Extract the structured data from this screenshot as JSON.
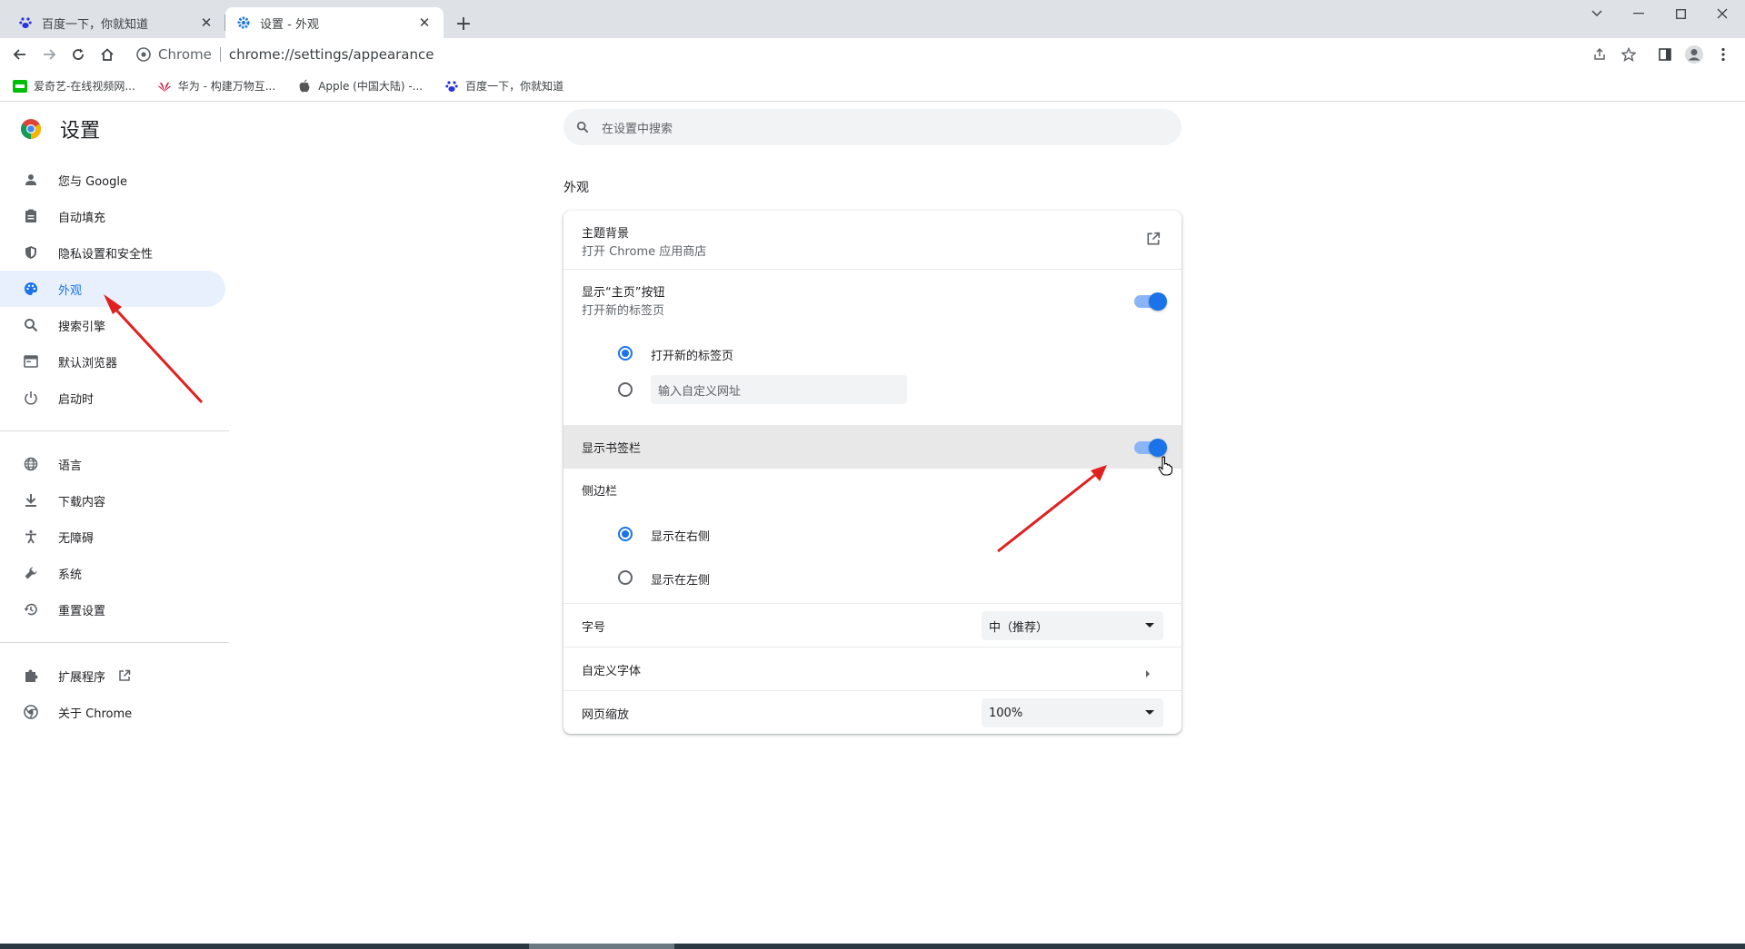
{
  "tabs": [
    {
      "title": "百度一下，你就知道",
      "icon": "baidu-paw-icon",
      "active": false
    },
    {
      "title": "设置 - 外观",
      "icon": "settings-gear-icon",
      "active": true
    }
  ],
  "omnibox": {
    "chip": "Chrome",
    "url": "chrome://settings/appearance"
  },
  "bookmarks": [
    {
      "label": "爱奇艺-在线视频网...",
      "icon": "iqiyi-icon"
    },
    {
      "label": "华为 - 构建万物互...",
      "icon": "huawei-icon"
    },
    {
      "label": "Apple (中国大陆) -...",
      "icon": "apple-icon"
    },
    {
      "label": "百度一下，你就知道",
      "icon": "baidu-paw-icon"
    }
  ],
  "settings_title": "设置",
  "search_placeholder": "在设置中搜索",
  "nav": {
    "group1": [
      {
        "label": "您与 Google",
        "icon": "person-icon"
      },
      {
        "label": "自动填充",
        "icon": "clipboard-icon"
      },
      {
        "label": "隐私设置和安全性",
        "icon": "shield-icon"
      },
      {
        "label": "外观",
        "icon": "palette-icon",
        "selected": true
      },
      {
        "label": "搜索引擎",
        "icon": "search-icon"
      },
      {
        "label": "默认浏览器",
        "icon": "browser-window-icon"
      },
      {
        "label": "启动时",
        "icon": "power-icon"
      }
    ],
    "group2": [
      {
        "label": "语言",
        "icon": "globe-icon"
      },
      {
        "label": "下载内容",
        "icon": "download-icon"
      },
      {
        "label": "无障碍",
        "icon": "accessibility-icon"
      },
      {
        "label": "系统",
        "icon": "wrench-icon"
      },
      {
        "label": "重置设置",
        "icon": "history-icon"
      }
    ],
    "group3": [
      {
        "label": "扩展程序",
        "icon": "puzzle-icon"
      },
      {
        "label": "关于 Chrome",
        "icon": "chrome-logo-icon"
      }
    ]
  },
  "section_title": "外观",
  "appearance": {
    "theme": {
      "label": "主题背景",
      "sub": "打开 Chrome 应用商店"
    },
    "home_button": {
      "label": "显示“主页”按钮",
      "sub": "打开新的标签页",
      "enabled": true
    },
    "home_options": {
      "new_tab": "打开新的标签页",
      "custom_placeholder": "输入自定义网址",
      "selected": "new_tab"
    },
    "bookmarks_bar": {
      "label": "显示书签栏",
      "enabled": true
    },
    "sidebar": {
      "label": "侧边栏",
      "right": "显示在右侧",
      "left": "显示在左侧",
      "selected": "right"
    },
    "font_size": {
      "label": "字号",
      "value": "中（推荐）"
    },
    "custom_fonts": {
      "label": "自定义字体"
    },
    "page_zoom": {
      "label": "网页缩放",
      "value": "100%"
    }
  },
  "colors": {
    "accent": "#1a73e8",
    "annotation_arrow": "#e02020"
  }
}
